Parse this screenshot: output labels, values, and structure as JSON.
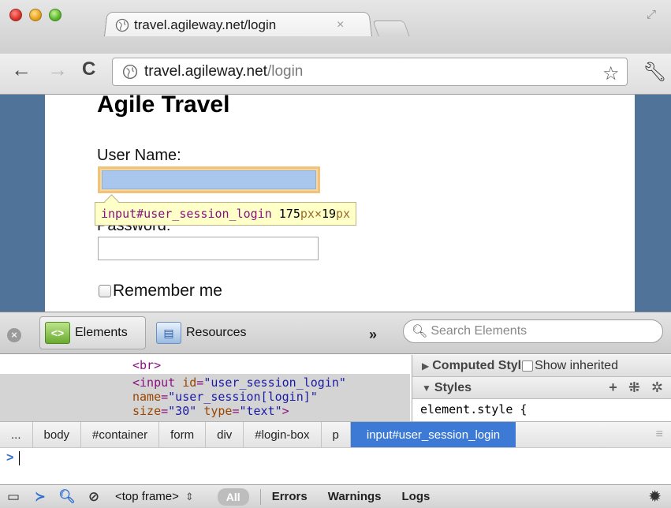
{
  "browser": {
    "tab_title": "travel.agileway.net/login",
    "tab_close": "×",
    "url_host": "travel.agileway.net",
    "url_path": "/login",
    "icons": [
      "globe-icon",
      "back-icon",
      "forward-icon",
      "reload-icon",
      "star-icon",
      "wrench-icon"
    ]
  },
  "page": {
    "title": "Agile Travel",
    "username_label": "User Name:",
    "password_label": "Password:",
    "remember_label": "Remember me"
  },
  "inspector_tooltip": {
    "selector": "input#user_session_login",
    "width": "175",
    "height": "19",
    "unit": "px",
    "times": "×"
  },
  "devtools": {
    "tabs": [
      {
        "label": "Elements",
        "active": true
      },
      {
        "label": "Resources",
        "active": false
      }
    ],
    "more": "»",
    "search_placeholder": "Search Elements",
    "dom": {
      "line1": "<br>",
      "input_open": "<input",
      "attr_id": "id",
      "val_id": "\"user_session_login\"",
      "attr_name": "name",
      "val_name": "\"user_session[login]\"",
      "attr_size": "size",
      "val_size": "\"30\"",
      "attr_type": "type",
      "val_type": "\"text\"",
      "input_close": ">"
    },
    "computed_style": "Computed Styl",
    "show_inherited": "Show inherited",
    "styles": "Styles",
    "element_style": "element.style {",
    "breadcrumbs": [
      "...",
      "body",
      "#container",
      "form",
      "div",
      "#login-box",
      "p",
      "input#user_session_login"
    ],
    "console_prompt": ">",
    "frame": "<top frame>",
    "filters": {
      "all": "All",
      "errors": "Errors",
      "warnings": "Warnings",
      "logs": "Logs"
    }
  }
}
